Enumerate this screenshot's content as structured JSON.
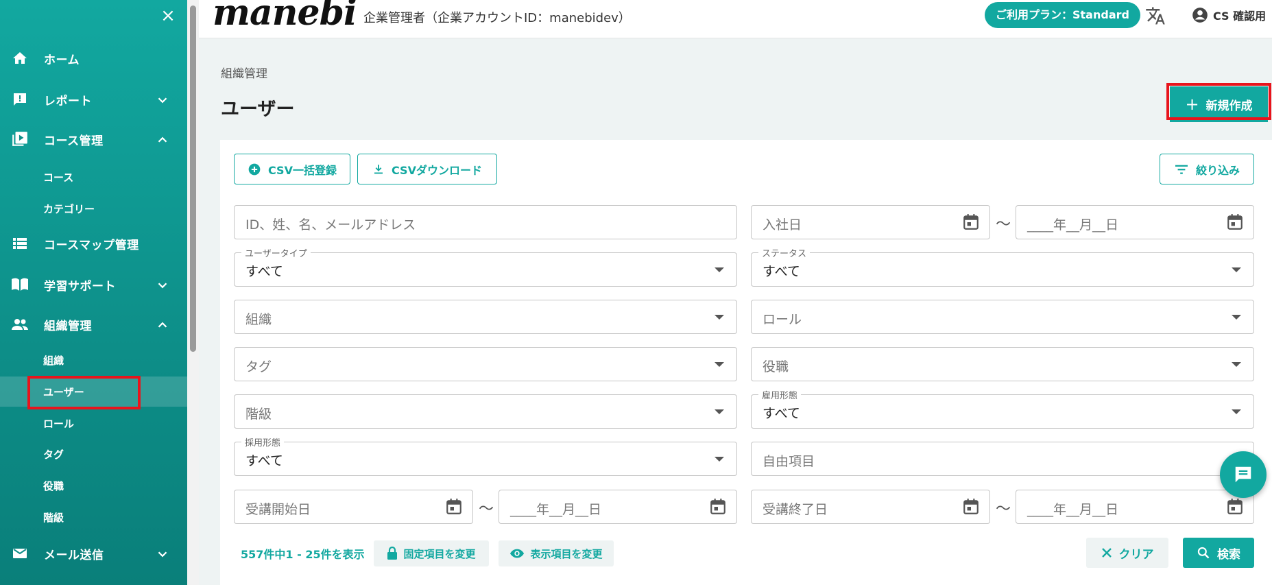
{
  "header": {
    "logo": "manebi",
    "company": "企業管理者（企業アカウントID：manebidev）",
    "plan": "ご利用プラン：Standard",
    "user_name": "CS 確認用"
  },
  "sidebar": {
    "close_icon": "×",
    "items": [
      {
        "label": "ホーム",
        "icon": "home-icon"
      },
      {
        "label": "レポート",
        "icon": "report-icon"
      },
      {
        "label": "コース管理",
        "icon": "course-icon"
      },
      {
        "label": "コースマップ管理",
        "icon": "list-icon"
      },
      {
        "label": "学習サポート",
        "icon": "book-icon"
      },
      {
        "label": "組織管理",
        "icon": "people-icon"
      },
      {
        "label": "メール送信",
        "icon": "mail-icon"
      }
    ],
    "course_sub": [
      "コース",
      "カテゴリー"
    ],
    "org_sub": [
      "組織",
      "ユーザー",
      "ロール",
      "タグ",
      "役職",
      "階級"
    ]
  },
  "main": {
    "breadcrumb": "組織管理",
    "title": "ユーザー",
    "new_button": "新規作成",
    "csv_import": "CSV一括登録",
    "csv_download": "CSVダウンロード",
    "filter": "絞り込み",
    "search_placeholder": "ID、姓、名、メールアドレス",
    "hire_date_placeholder": "入社日",
    "date_placeholder": "____年__月__日",
    "tilde": "～",
    "user_type_label": "ユーザータイプ",
    "user_type_value": "すべて",
    "status_label": "ステータス",
    "status_value": "すべて",
    "org_placeholder": "組織",
    "role_placeholder": "ロール",
    "tag_placeholder": "タグ",
    "position_placeholder": "役職",
    "rank_placeholder": "階級",
    "employment_label": "雇用形態",
    "employment_value": "すべて",
    "hiring_label": "採用形態",
    "hiring_value": "すべて",
    "free_field_placeholder": "自由項目",
    "course_start_placeholder": "受講開始日",
    "course_end_placeholder": "受講終了日",
    "result_count": "557件中1 - 25件を表示",
    "fixed_columns_button": "固定項目を変更",
    "display_columns_button": "表示項目を変更",
    "clear_button": "クリア",
    "search_button": "検索"
  },
  "colors": {
    "accent": "#12a8a0",
    "highlight": "#e8141c"
  }
}
